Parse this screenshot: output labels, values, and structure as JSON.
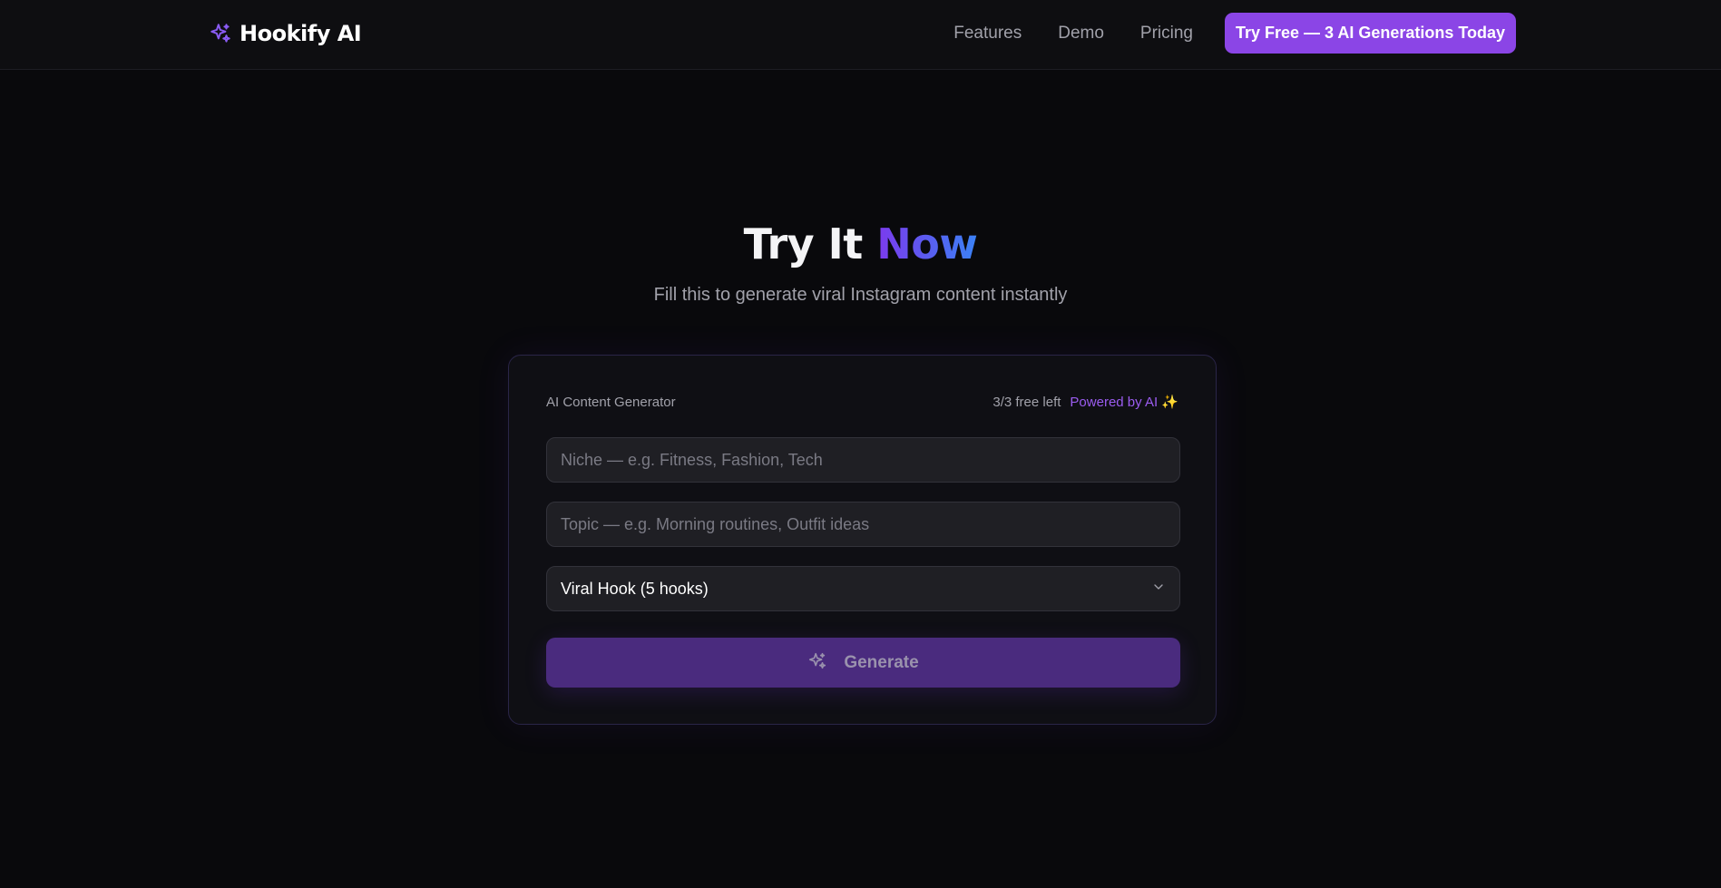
{
  "nav": {
    "brand": "Hookify AI",
    "brand_icon": "sparkles-icon",
    "links": [
      "Features",
      "Demo",
      "Pricing"
    ],
    "cta_label": "Try Free — 3 AI Generations Today"
  },
  "hero": {
    "title_main": "Try It",
    "title_accent": "Now",
    "subtitle": "Fill this to generate viral Instagram content instantly"
  },
  "generator": {
    "label": "AI Content Generator",
    "free_left": "3/3 free left",
    "powered": "Powered by AI ✨",
    "niche_placeholder": "Niche — e.g. Fitness, Fashion, Tech",
    "topic_placeholder": "Topic — e.g. Morning routines, Outfit ideas",
    "selected_type": "Viral Hook (5 hooks)",
    "generate_label": "Generate"
  },
  "colors": {
    "accent": "#8b45e6",
    "background": "#09090c"
  }
}
